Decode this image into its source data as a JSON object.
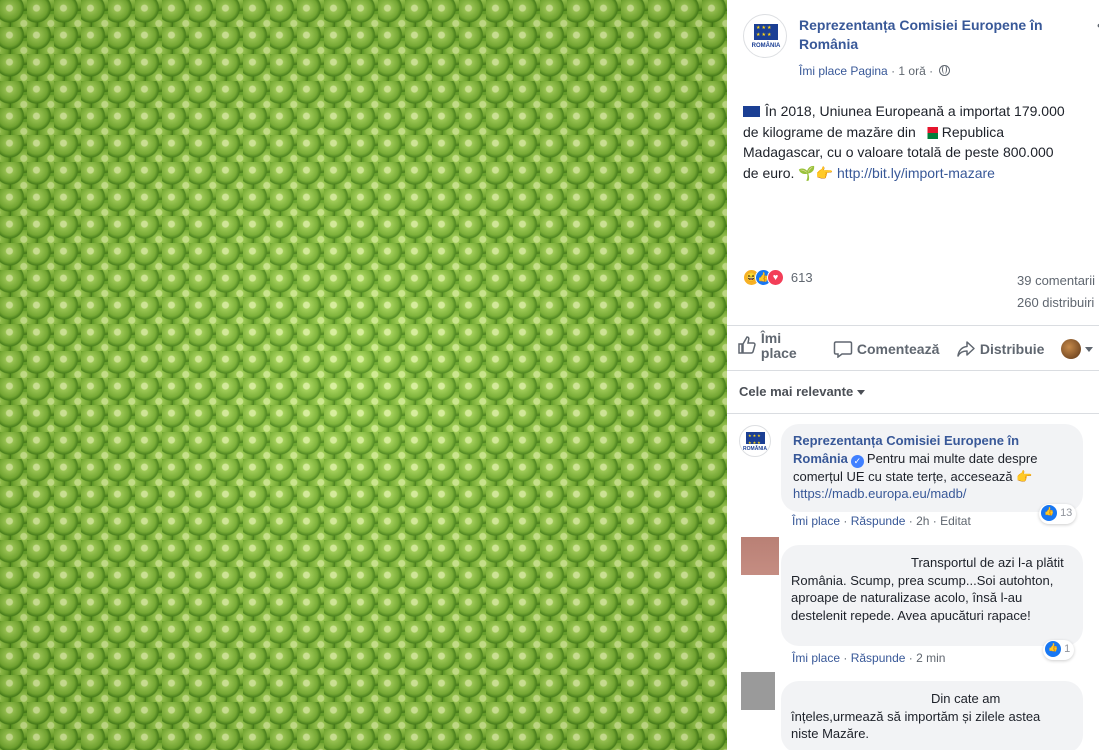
{
  "photo": {
    "subject": "green-peas"
  },
  "post": {
    "page_name": "Reprezentanța Comisiei Europene în România",
    "avatar_text": "ROMÂNIA",
    "like_page": "Îmi place Pagina",
    "separator": "·",
    "time": "1 oră",
    "text_line1": "În 2018, Uniunea Europeană a importat 179.000",
    "text_line2a": "de kilograme de mazăre din",
    "text_line2b": "Republica",
    "text_line3": "Madagascar, cu o valoare totală de peste 800.000",
    "text_line4": "de euro. 🌱👉",
    "link": "http://bit.ly/import-mazare",
    "reaction_count": "613",
    "comments_count": "39 comentarii",
    "shares_count": "260 distribuiri"
  },
  "actions": {
    "like": "Îmi place",
    "comment": "Comentează",
    "share": "Distribuie"
  },
  "sort": {
    "label": "Cele mai relevante"
  },
  "comments": [
    {
      "author": "Reprezentanța Comisiei Europene în România",
      "text": "Pentru mai multe date despre comerțul UE cu state terțe, accesează 👉",
      "link": "https://madb.europa.eu/madb/",
      "like": "Îmi place",
      "reply": "Răspunde",
      "time": "2h",
      "edited": "Editat",
      "reactions": "13"
    },
    {
      "text": "Transportul de azi l-a plătit România. Scump, prea scump...Soi autohton, aproape de naturalizase acolo, însă l-au destelenit repede. Avea apucături rapace!",
      "like": "Îmi place",
      "reply": "Răspunde",
      "time": "2 min",
      "reactions": "1"
    },
    {
      "text": "Din cate am înțeles,urmează să importăm și zilele astea niste Mazăre."
    }
  ],
  "colors": {
    "link": "#385898",
    "muted": "#606770",
    "bubble": "#f2f3f5",
    "like_blue": "#1877f2"
  }
}
